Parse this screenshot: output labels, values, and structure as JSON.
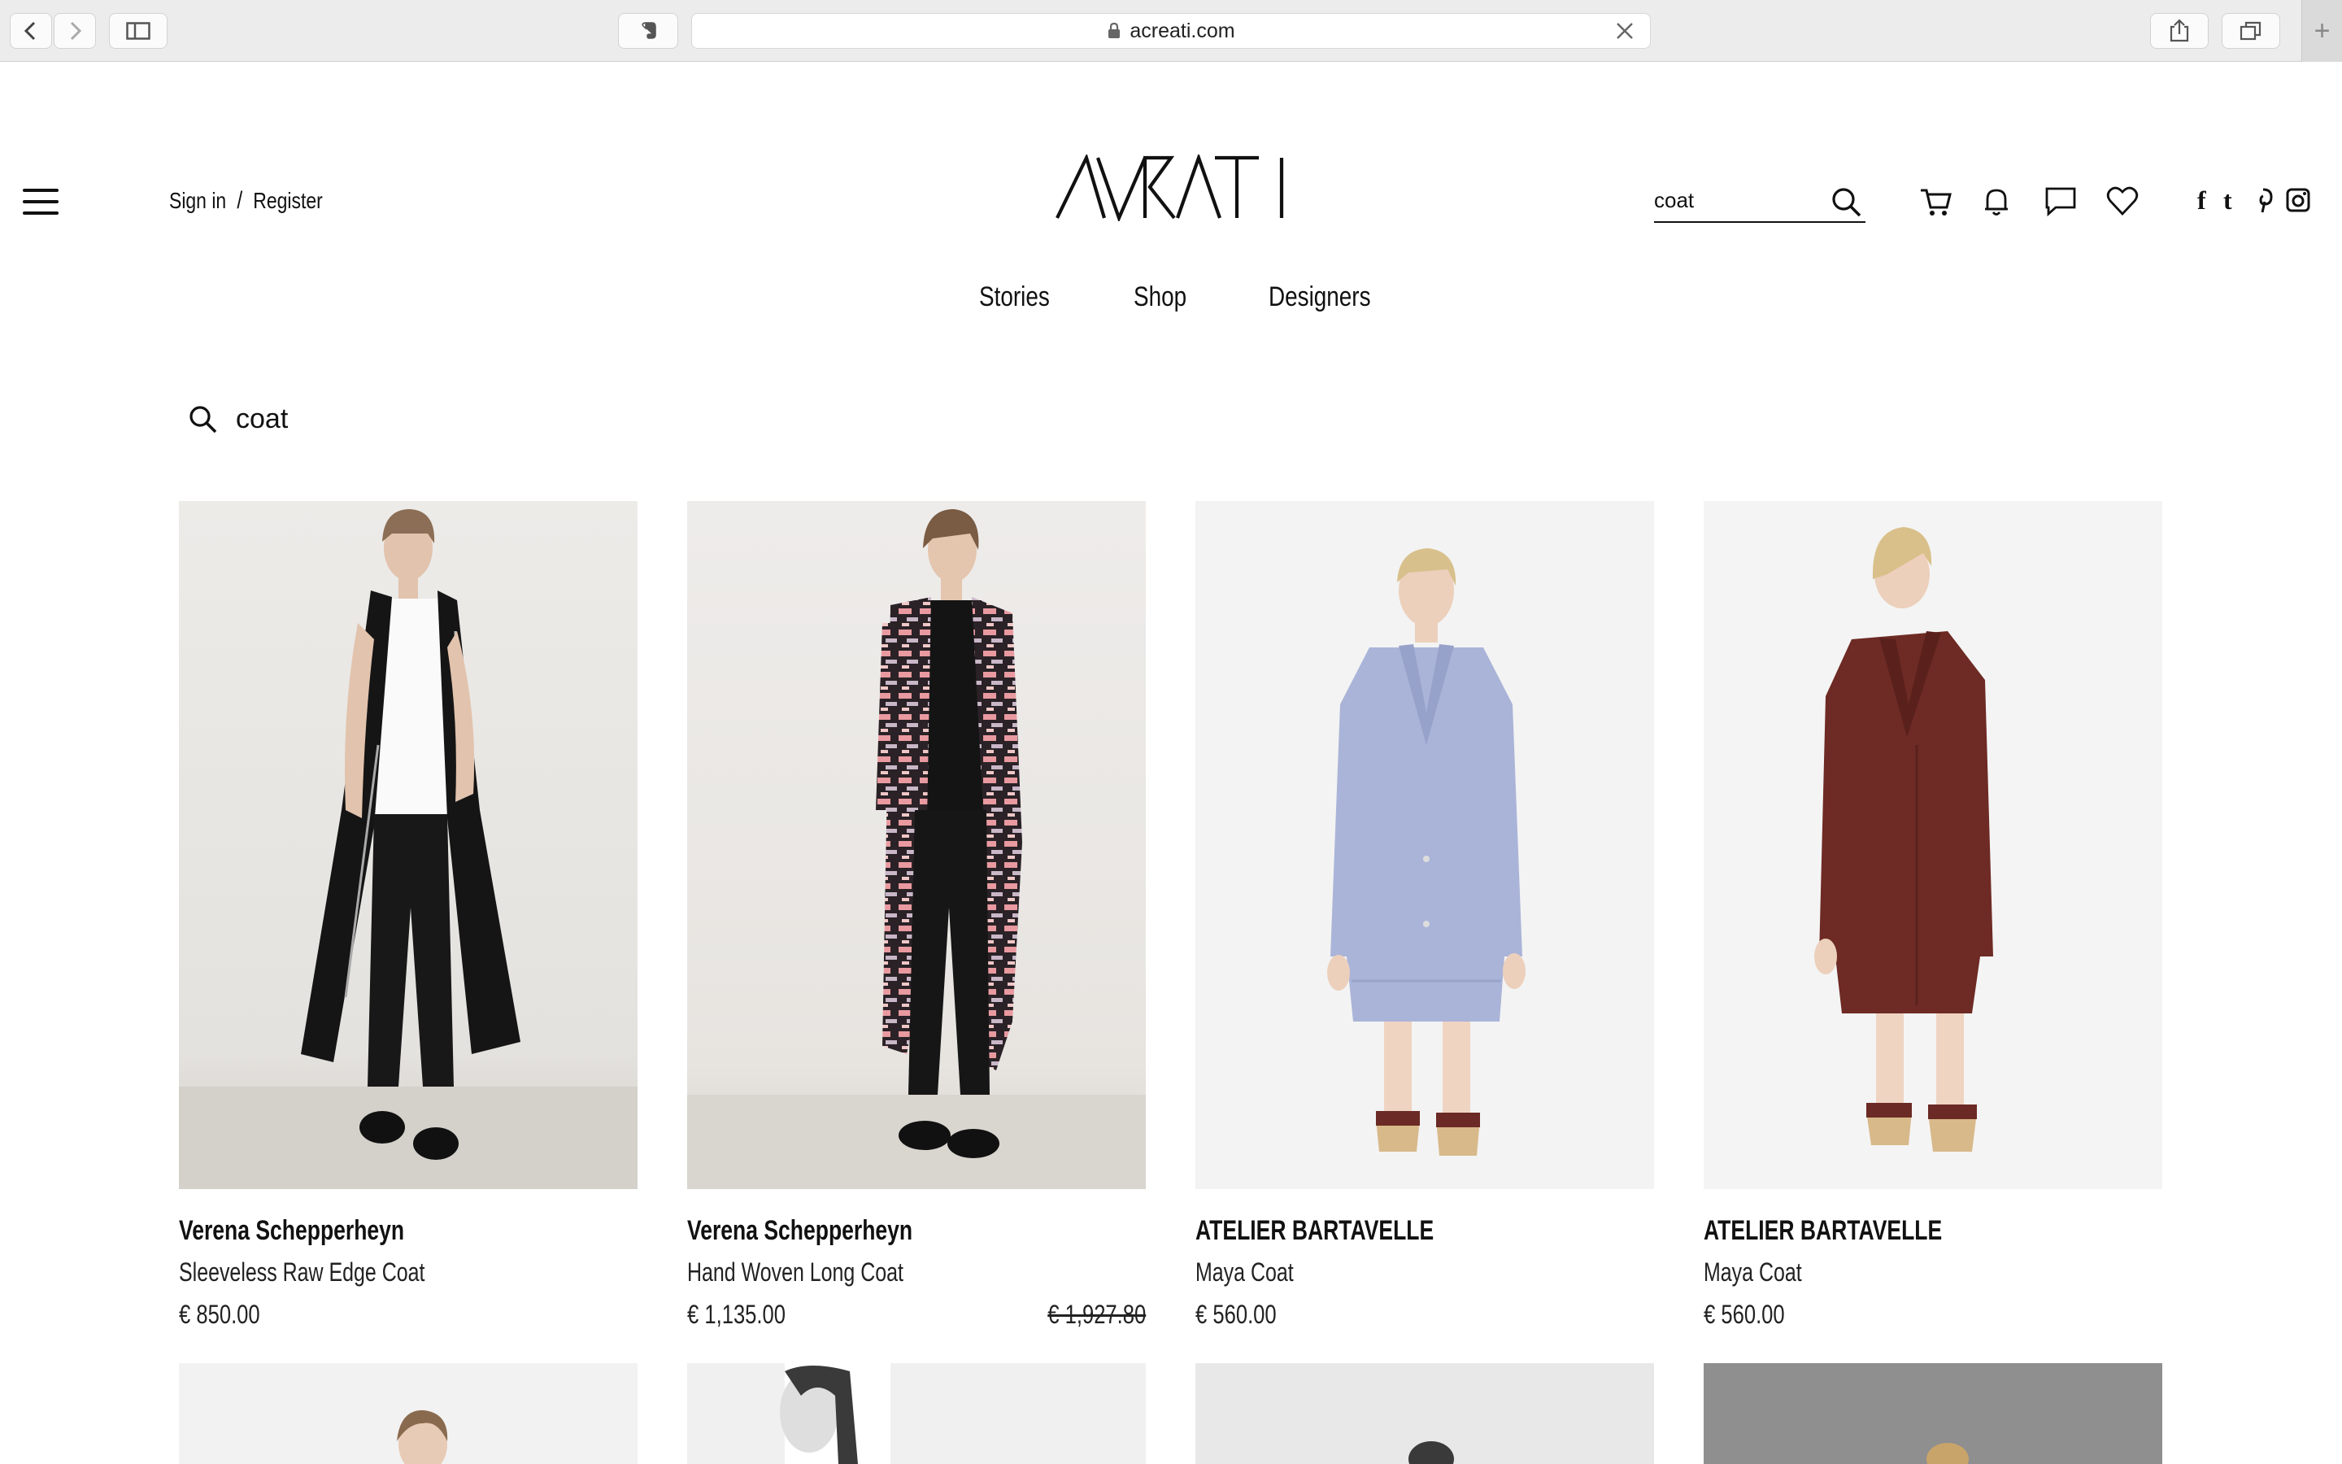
{
  "browser": {
    "url": "acreati.com"
  },
  "header": {
    "sign_in": "Sign in",
    "separator": "/",
    "register": "Register",
    "logo_text": "ACREATI",
    "search_value": "coat"
  },
  "nav": {
    "items": [
      "Stories",
      "Shop",
      "Designers"
    ]
  },
  "search_results": {
    "query": "coat"
  },
  "products": [
    {
      "brand": "Verena Schepperheyn",
      "name": "Sleeveless Raw Edge Coat",
      "price": "€ 850.00",
      "old_price": ""
    },
    {
      "brand": "Verena Schepperheyn",
      "name": "Hand Woven Long Coat",
      "price": "€ 1,135.00",
      "old_price": "€ 1,927.80"
    },
    {
      "brand": "ATELIER BARTAVELLE",
      "name": "Maya Coat",
      "price": "€ 560.00",
      "old_price": ""
    },
    {
      "brand": "ATELIER BARTAVELLE",
      "name": "Maya Coat",
      "price": "€ 560.00",
      "old_price": ""
    }
  ],
  "colors": {
    "text": "#111111",
    "coat_black": "#151515",
    "coat_lavender": "#aab4d8",
    "coat_burgundy": "#6e2a24"
  }
}
